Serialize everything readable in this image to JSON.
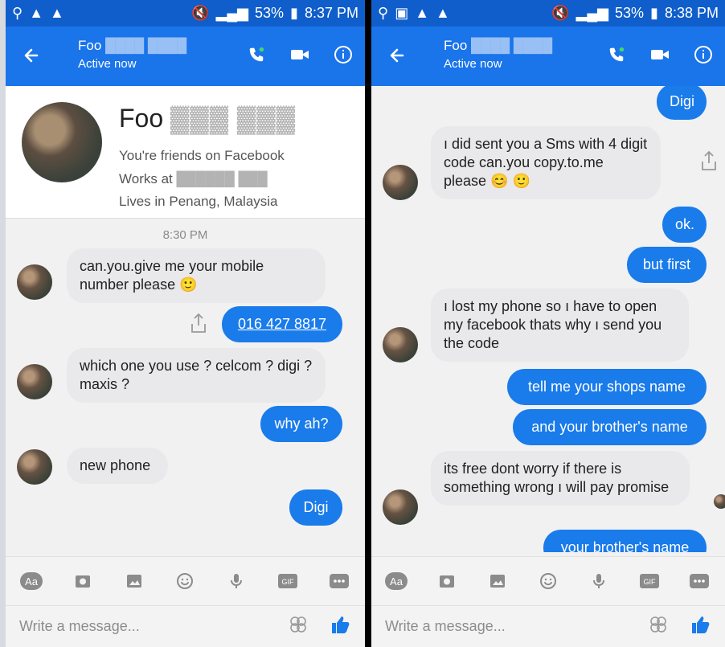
{
  "left": {
    "status": {
      "time": "8:37 PM",
      "battery": "53%"
    },
    "contact": {
      "name": "Foo",
      "status": "Active now"
    },
    "profile": {
      "name": "Foo",
      "friends": "You're friends on Facebook",
      "works": "Works at",
      "lives": "Lives in Penang, Malaysia"
    },
    "timestamp": "8:30 PM",
    "messages": [
      {
        "text": "can.you.give me your mobile number please 🙂"
      },
      {
        "text": "016 427 8817"
      },
      {
        "text": "which one you use ? celcom ? digi ? maxis ?"
      },
      {
        "text": "why ah?"
      },
      {
        "text": "new phone"
      },
      {
        "text": "Digi"
      }
    ],
    "composer": {
      "placeholder": "Write a message..."
    }
  },
  "right": {
    "status": {
      "time": "8:38 PM",
      "battery": "53%"
    },
    "contact": {
      "name": "Foo",
      "status": "Active now"
    },
    "messages": [
      {
        "text": "Digi"
      },
      {
        "text": "ı did sent you a Sms with 4 digit code can.you copy.to.me please 😊 🙂"
      },
      {
        "text": "ok."
      },
      {
        "text": "but first"
      },
      {
        "text": "ı lost my phone so ı have to open my facebook thats why ı send you the code"
      },
      {
        "text": "tell me your shops name"
      },
      {
        "text": "and your brother's name"
      },
      {
        "text": "its free dont worry if there is something wrong ı will pay promise"
      },
      {
        "text": "your brother's name"
      }
    ],
    "composer": {
      "placeholder": "Write a message..."
    }
  },
  "toolbar": [
    "Aa",
    "camera",
    "image",
    "emoji",
    "mic",
    "GIF",
    "more"
  ],
  "colors": {
    "statusbar": "#0f5ecb",
    "appbar": "#1a74ea",
    "bubble_out": "#1a7bea",
    "bubble_in": "#e9e9eb",
    "bg": "#f1f1f2"
  }
}
